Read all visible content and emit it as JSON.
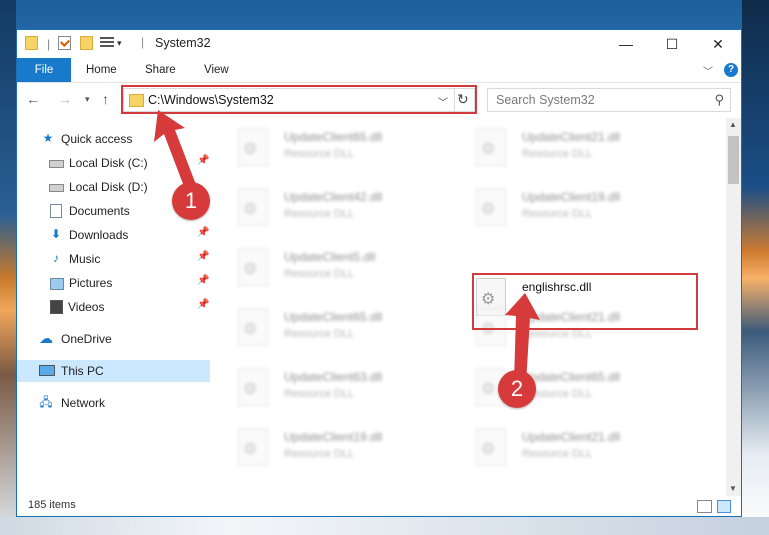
{
  "window": {
    "title": "System32",
    "controls": {
      "minimize": "—",
      "maximize": "☐",
      "close": "✕"
    }
  },
  "ribbon": {
    "file": "File",
    "tabs": [
      "Home",
      "Share",
      "View"
    ]
  },
  "address": {
    "path": "C:\\Windows\\System32",
    "search_placeholder": "Search System32"
  },
  "nav": {
    "items": [
      {
        "label": "Quick access",
        "icon": "star-icon",
        "pinned": false
      },
      {
        "label": "Local Disk (C:)",
        "icon": "disk-icon",
        "pinned": true
      },
      {
        "label": "Local Disk (D:)",
        "icon": "disk-icon",
        "pinned": false
      },
      {
        "label": "Documents",
        "icon": "documents-icon",
        "pinned": false
      },
      {
        "label": "Downloads",
        "icon": "download-icon",
        "pinned": true
      },
      {
        "label": "Music",
        "icon": "music-icon",
        "pinned": true
      },
      {
        "label": "Pictures",
        "icon": "pictures-icon",
        "pinned": true
      },
      {
        "label": "Videos",
        "icon": "videos-icon",
        "pinned": true
      },
      {
        "label": "OneDrive",
        "icon": "cloud-icon",
        "pinned": false
      },
      {
        "label": "This PC",
        "icon": "pc-icon",
        "pinned": false,
        "selected": true
      },
      {
        "label": "Network",
        "icon": "network-icon",
        "pinned": false
      }
    ]
  },
  "files": {
    "left": [
      {
        "name": "UpdateClient65.dll",
        "type": "Resource DLL"
      },
      {
        "name": "UpdateClient42.dll",
        "type": "Resource DLL"
      },
      {
        "name": "UpdateClient5.dll",
        "type": "Resource DLL"
      },
      {
        "name": "UpdateClient65.dll",
        "type": "Resource DLL"
      },
      {
        "name": "UpdateClient63.dll",
        "type": "Resource DLL"
      },
      {
        "name": "UpdateClient19.dll",
        "type": "Resource DLL"
      }
    ],
    "right": [
      {
        "name": "UpdateClient21.dll",
        "type": "Resource DLL"
      },
      {
        "name": "UpdateClient19.dll",
        "type": "Resource DLL"
      },
      {
        "name": "englishrsc.dll",
        "type": ""
      },
      {
        "name": "UpdateClient21.dll",
        "type": "Resource DLL"
      },
      {
        "name": "UpdateClient65.dll",
        "type": "Resource DLL"
      },
      {
        "name": "UpdateClient21.dll",
        "type": "Resource DLL"
      }
    ]
  },
  "status": {
    "item_count": "185 items"
  },
  "annotations": {
    "step1": "1",
    "step2": "2",
    "color": "#d63a3a"
  }
}
